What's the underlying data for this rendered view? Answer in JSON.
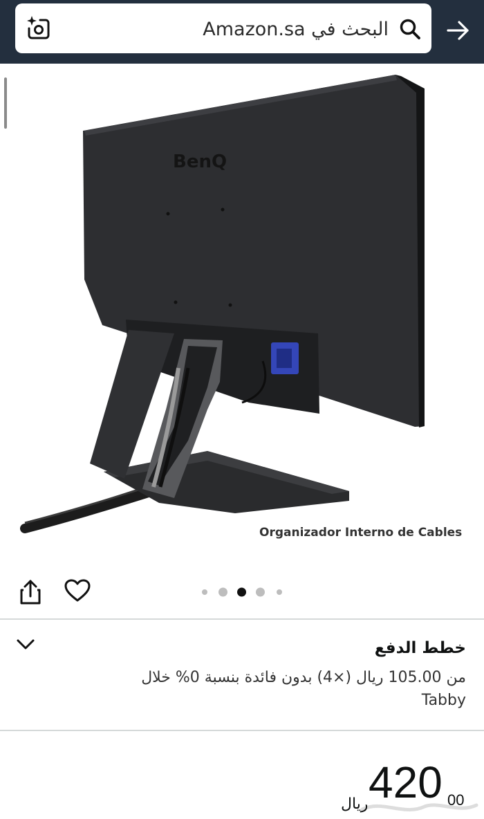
{
  "header": {
    "search_placeholder": "البحث في Amazon.sa",
    "search_icon": "search-icon",
    "camera_icon": "camera-sparkle-icon",
    "back_icon": "arrow-right-icon",
    "background_color": "#232f3e"
  },
  "product_image": {
    "brand_logo": "BenQ",
    "caption": "Organizador Interno de Cables",
    "carousel": {
      "count": 5,
      "active_index": 2
    }
  },
  "actions": {
    "share_icon": "share-icon",
    "wishlist_icon": "heart-icon"
  },
  "payment_plan": {
    "title": "خطط الدفع",
    "line1": "من 105.00 ريال (×4) بدون فائدة بنسبة 0% خلال",
    "line2": "Tabby",
    "expand_icon": "chevron-down-icon"
  },
  "price": {
    "currency": "ريال",
    "whole": "420",
    "fraction": "00"
  }
}
